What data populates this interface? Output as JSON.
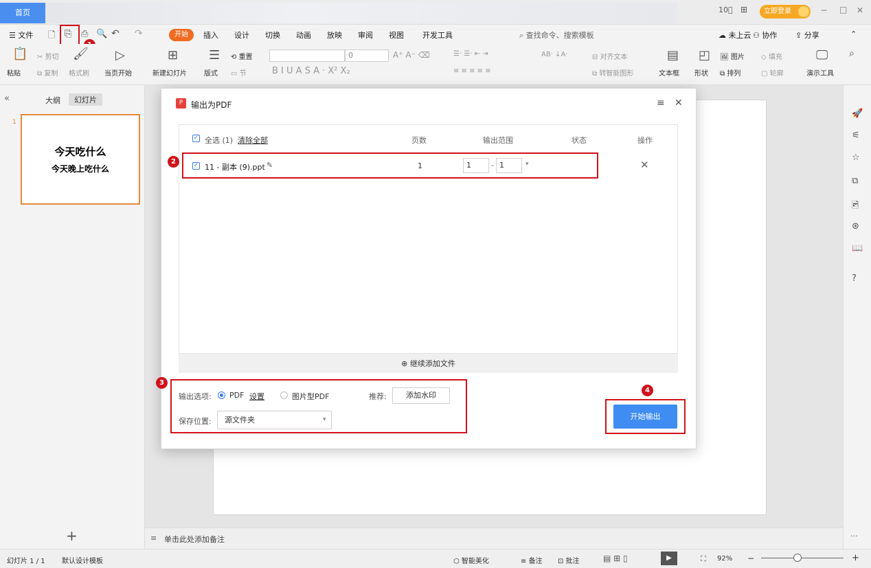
{
  "window": {
    "home_tab": "首页",
    "login_button": "立即登录",
    "ctl_min": "─",
    "ctl_max": "□",
    "ctl_close": "✕"
  },
  "menu": {
    "file": "文件",
    "tabs": [
      "开始",
      "插入",
      "设计",
      "切换",
      "动画",
      "放映",
      "审阅",
      "视图",
      "开发工具"
    ],
    "search_placeholder": "查找命令、搜索模板",
    "cloud": "未上云",
    "collab": "协作",
    "share": "分享"
  },
  "ribbon": {
    "paste": "粘贴",
    "cut": "剪切",
    "copy": "复制",
    "format_painter": "格式刷",
    "from_current": "当页开始",
    "new_slide": "新建幻灯片",
    "layout": "版式",
    "reset": "重置",
    "section": "节",
    "font_size": "0",
    "align_text": "对齐文本",
    "smart_graphic": "转智能图形",
    "textbox": "文本框",
    "shape": "形状",
    "picture": "图片",
    "arrange": "排列",
    "fill": "填充",
    "outline": "轮廓",
    "present_tools": "演示工具"
  },
  "left_panel": {
    "tab_outline": "大纲",
    "tab_slides": "幻灯片",
    "slide_number": "1",
    "slide_title": "今天吃什么",
    "slide_subtitle": "今天晚上吃什么",
    "add_slide": "+"
  },
  "dialog": {
    "title": "输出为PDF",
    "select_all": "全选 (1)",
    "clear_all": "清除全部",
    "col_pages": "页数",
    "col_range": "输出范围",
    "col_status": "状态",
    "col_action": "操作",
    "file_name": "11 - 副本 (9).ppt",
    "file_pages": "1",
    "range_from": "1",
    "range_to": "1",
    "add_more": "继续添加文件",
    "output_options_label": "输出选项:",
    "opt_pdf": "PDF",
    "settings_link": "设置",
    "opt_image_pdf": "图片型PDF",
    "recommend_label": "推荐:",
    "watermark_button": "添加水印",
    "save_location_label": "保存位置:",
    "save_location_value": "源文件夹",
    "start_button": "开始输出"
  },
  "annotations": [
    "1",
    "2",
    "3",
    "4"
  ],
  "notes_placeholder": "单击此处添加备注",
  "status": {
    "slide_count": "幻灯片 1 / 1",
    "template": "默认设计模板",
    "beautify": "智能美化",
    "notes": "备注",
    "comments": "批注",
    "zoom": "92%"
  },
  "colors": {
    "accent": "#3f8cf2",
    "annotation_red": "#d0121b",
    "start_tab": "#f06b1f",
    "login": "#f7a823"
  }
}
